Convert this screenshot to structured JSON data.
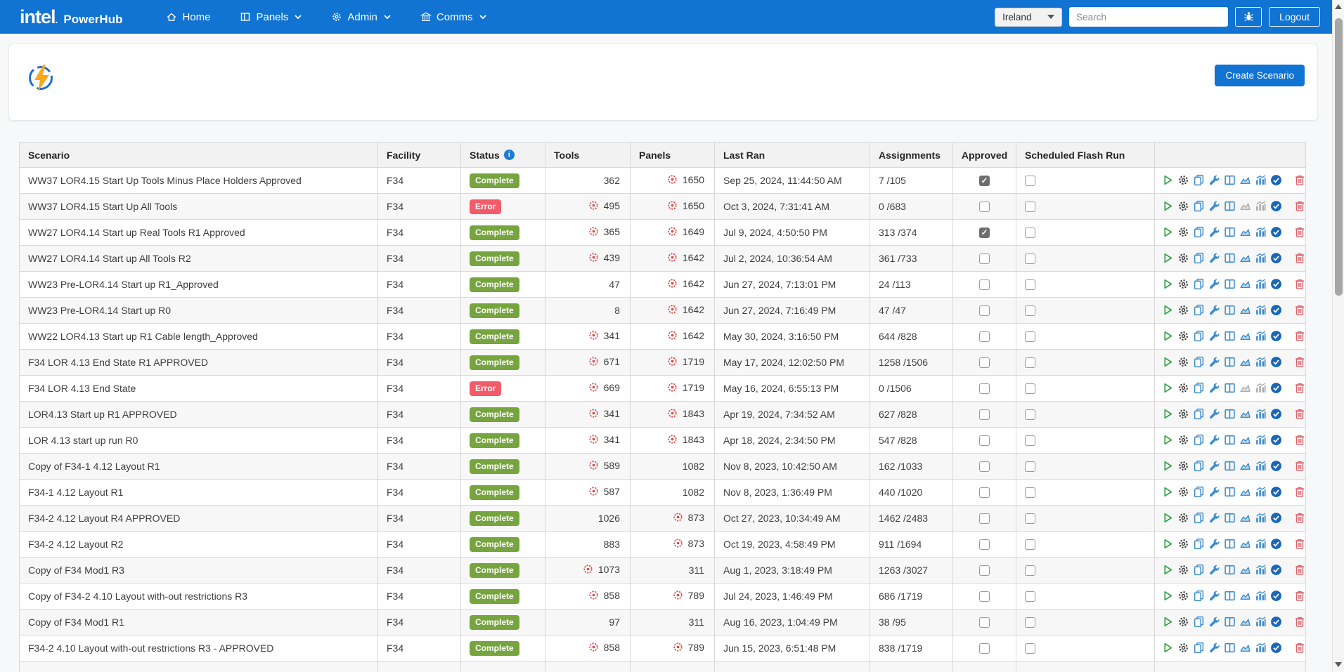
{
  "navbar": {
    "brand": {
      "logo": "intel",
      "logo_dot": ".",
      "app": "PowerHub"
    },
    "items": [
      {
        "label": "Home",
        "icon": "home-icon",
        "has_dropdown": false
      },
      {
        "label": "Panels",
        "icon": "panels-icon",
        "has_dropdown": true
      },
      {
        "label": "Admin",
        "icon": "gear-icon",
        "has_dropdown": true
      },
      {
        "label": "Comms",
        "icon": "building-icon",
        "has_dropdown": true
      }
    ],
    "region_select": {
      "value": "Ireland"
    },
    "search": {
      "placeholder": "Search",
      "value": ""
    },
    "bug_button_icon": "bug-icon",
    "logout_label": "Logout"
  },
  "toolbar": {
    "create_button": "Create Scenario",
    "header_icon": "lightning-icon"
  },
  "table": {
    "columns": [
      "Scenario",
      "Facility",
      "Status",
      "Tools",
      "Panels",
      "Last Ran",
      "Assignments",
      "Approved",
      "Scheduled Flash Run",
      ""
    ],
    "status_info_icon": "info-icon",
    "count_warning_icon": "target-icon",
    "action_icons": [
      "run-icon",
      "settings-icon",
      "copy-icon",
      "wrench-icon",
      "table-columns-icon",
      "area-chart-icon",
      "bar-chart-icon",
      "check-circle-icon",
      "trash-icon"
    ],
    "rows": [
      {
        "scenario": "WW37 LOR4.15 Start Up Tools Minus Place Holders Approved",
        "facility": "F34",
        "status": "Complete",
        "tools": "362",
        "tools_alert": false,
        "panels": "1650",
        "panels_alert": true,
        "last_ran": "Sep 25, 2024, 11:44:50 AM",
        "assignments": "7 /105",
        "approved": true,
        "scheduled_flash_run": false,
        "charts_enabled": true
      },
      {
        "scenario": "WW37 LOR4.15 Start Up All Tools",
        "facility": "F34",
        "status": "Error",
        "tools": "495",
        "tools_alert": true,
        "panels": "1650",
        "panels_alert": true,
        "last_ran": "Oct 3, 2024, 7:31:41 AM",
        "assignments": "0 /683",
        "approved": false,
        "scheduled_flash_run": false,
        "charts_enabled": false
      },
      {
        "scenario": "WW27 LOR4.14 Start up Real Tools R1 Approved",
        "facility": "F34",
        "status": "Complete",
        "tools": "365",
        "tools_alert": true,
        "panels": "1649",
        "panels_alert": true,
        "last_ran": "Jul 9, 2024, 4:50:50 PM",
        "assignments": "313 /374",
        "approved": true,
        "scheduled_flash_run": false,
        "charts_enabled": true
      },
      {
        "scenario": "WW27 LOR4.14 Start up All Tools R2",
        "facility": "F34",
        "status": "Complete",
        "tools": "439",
        "tools_alert": true,
        "panels": "1642",
        "panels_alert": true,
        "last_ran": "Jul 2, 2024, 10:36:54 AM",
        "assignments": "361 /733",
        "approved": false,
        "scheduled_flash_run": false,
        "charts_enabled": true
      },
      {
        "scenario": "WW23 Pre-LOR4.14 Start up R1_Approved",
        "facility": "F34",
        "status": "Complete",
        "tools": "47",
        "tools_alert": false,
        "panels": "1642",
        "panels_alert": true,
        "last_ran": "Jun 27, 2024, 7:13:01 PM",
        "assignments": "24 /113",
        "approved": false,
        "scheduled_flash_run": false,
        "charts_enabled": true
      },
      {
        "scenario": "WW23 Pre-LOR4.14 Start up R0",
        "facility": "F34",
        "status": "Complete",
        "tools": "8",
        "tools_alert": false,
        "panels": "1642",
        "panels_alert": true,
        "last_ran": "Jun 27, 2024, 7:16:49 PM",
        "assignments": "47 /47",
        "approved": false,
        "scheduled_flash_run": false,
        "charts_enabled": true
      },
      {
        "scenario": "WW22 LOR4.13 Start up R1 Cable length_Approved",
        "facility": "F34",
        "status": "Complete",
        "tools": "341",
        "tools_alert": true,
        "panels": "1642",
        "panels_alert": true,
        "last_ran": "May 30, 2024, 3:16:50 PM",
        "assignments": "644 /828",
        "approved": false,
        "scheduled_flash_run": false,
        "charts_enabled": true
      },
      {
        "scenario": "F34 LOR 4.13 End State R1 APPROVED",
        "facility": "F34",
        "status": "Complete",
        "tools": "671",
        "tools_alert": true,
        "panels": "1719",
        "panels_alert": true,
        "last_ran": "May 17, 2024, 12:02:50 PM",
        "assignments": "1258 /1506",
        "approved": false,
        "scheduled_flash_run": false,
        "charts_enabled": true
      },
      {
        "scenario": "F34 LOR 4.13 End State",
        "facility": "F34",
        "status": "Error",
        "tools": "669",
        "tools_alert": true,
        "panels": "1719",
        "panels_alert": true,
        "last_ran": "May 16, 2024, 6:55:13 PM",
        "assignments": "0 /1506",
        "approved": false,
        "scheduled_flash_run": false,
        "charts_enabled": false
      },
      {
        "scenario": "LOR4.13 Start up R1 APPROVED",
        "facility": "F34",
        "status": "Complete",
        "tools": "341",
        "tools_alert": true,
        "panels": "1843",
        "panels_alert": true,
        "last_ran": "Apr 19, 2024, 7:34:52 AM",
        "assignments": "627 /828",
        "approved": false,
        "scheduled_flash_run": false,
        "charts_enabled": true
      },
      {
        "scenario": "LOR 4.13 start up run R0",
        "facility": "F34",
        "status": "Complete",
        "tools": "341",
        "tools_alert": true,
        "panels": "1843",
        "panels_alert": true,
        "last_ran": "Apr 18, 2024, 2:34:50 PM",
        "assignments": "547 /828",
        "approved": false,
        "scheduled_flash_run": false,
        "charts_enabled": true
      },
      {
        "scenario": "Copy of F34-1 4.12 Layout R1",
        "facility": "F34",
        "status": "Complete",
        "tools": "589",
        "tools_alert": true,
        "panels": "1082",
        "panels_alert": false,
        "last_ran": "Nov 8, 2023, 10:42:50 AM",
        "assignments": "162 /1033",
        "approved": false,
        "scheduled_flash_run": false,
        "charts_enabled": true
      },
      {
        "scenario": "F34-1 4.12 Layout R1",
        "facility": "F34",
        "status": "Complete",
        "tools": "587",
        "tools_alert": true,
        "panels": "1082",
        "panels_alert": false,
        "last_ran": "Nov 8, 2023, 1:36:49 PM",
        "assignments": "440 /1020",
        "approved": false,
        "scheduled_flash_run": false,
        "charts_enabled": true
      },
      {
        "scenario": "F34-2 4.12 Layout R4 APPROVED",
        "facility": "F34",
        "status": "Complete",
        "tools": "1026",
        "tools_alert": false,
        "panels": "873",
        "panels_alert": true,
        "last_ran": "Oct 27, 2023, 10:34:49 AM",
        "assignments": "1462 /2483",
        "approved": false,
        "scheduled_flash_run": false,
        "charts_enabled": true
      },
      {
        "scenario": "F34-2 4.12 Layout R2",
        "facility": "F34",
        "status": "Complete",
        "tools": "883",
        "tools_alert": false,
        "panels": "873",
        "panels_alert": true,
        "last_ran": "Oct 19, 2023, 4:58:49 PM",
        "assignments": "911 /1694",
        "approved": false,
        "scheduled_flash_run": false,
        "charts_enabled": true
      },
      {
        "scenario": "Copy of F34 Mod1 R3",
        "facility": "F34",
        "status": "Complete",
        "tools": "1073",
        "tools_alert": true,
        "panels": "311",
        "panels_alert": false,
        "last_ran": "Aug 1, 2023, 3:18:49 PM",
        "assignments": "1263 /3027",
        "approved": false,
        "scheduled_flash_run": false,
        "charts_enabled": true
      },
      {
        "scenario": "Copy of F34-2 4.10 Layout with-out restrictions R3",
        "facility": "F34",
        "status": "Complete",
        "tools": "858",
        "tools_alert": true,
        "panels": "789",
        "panels_alert": true,
        "last_ran": "Jul 24, 2023, 1:46:49 PM",
        "assignments": "686 /1719",
        "approved": false,
        "scheduled_flash_run": false,
        "charts_enabled": true
      },
      {
        "scenario": "Copy of F34 Mod1 R1",
        "facility": "F34",
        "status": "Complete",
        "tools": "97",
        "tools_alert": false,
        "panels": "311",
        "panels_alert": false,
        "last_ran": "Aug 16, 2023, 1:04:49 PM",
        "assignments": "38 /95",
        "approved": false,
        "scheduled_flash_run": false,
        "charts_enabled": true
      },
      {
        "scenario": "F34-2 4.10 Layout with-out restrictions R3 - APPROVED",
        "facility": "F34",
        "status": "Complete",
        "tools": "858",
        "tools_alert": true,
        "panels": "789",
        "panels_alert": true,
        "last_ran": "Jun 15, 2023, 6:51:48 PM",
        "assignments": "838 /1719",
        "approved": false,
        "scheduled_flash_run": false,
        "charts_enabled": true
      }
    ]
  },
  "colors": {
    "navbar_blue": "#1173D2",
    "button_blue": "#1173D2",
    "status_complete_green": "#76A43F",
    "status_error_red": "#F25C69",
    "warning_icon_red": "#E53E3E",
    "bolt_orange": "#F8A91B"
  }
}
